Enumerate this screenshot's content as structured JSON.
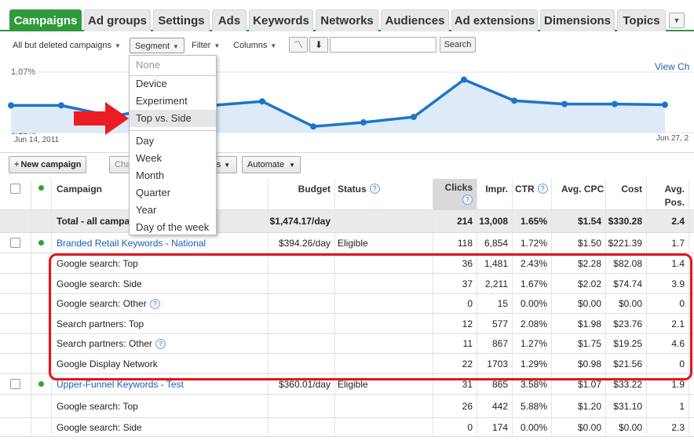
{
  "tabs": [
    "Campaigns",
    "Ad groups",
    "Settings",
    "Ads",
    "Keywords",
    "Networks",
    "Audiences",
    "Ad extensions",
    "Dimensions",
    "Topics"
  ],
  "toolbar": {
    "filter_view": "All but deleted campaigns",
    "segment": "Segment",
    "filter": "Filter",
    "columns": "Columns",
    "search_button": "Search",
    "search_value": ""
  },
  "chart": {
    "y_max_label": "1.07%",
    "y_min_label": "0.18%",
    "x_start": "Jun 14, 2011",
    "x_end": "Jun 27, 2",
    "link": "View Ch",
    "line_color": "#1b76c8",
    "fill_color": "#dcebf7",
    "y_range": [
      0.18,
      1.07
    ],
    "values": [
      0.58,
      0.58,
      0.42,
      0.55,
      0.58,
      0.64,
      0.27,
      0.33,
      0.41,
      0.96,
      0.65,
      0.6,
      0.6,
      0.59
    ]
  },
  "segment_menu": {
    "items": [
      "None",
      "Device",
      "Experiment",
      "Top vs. Side",
      "Day",
      "Week",
      "Month",
      "Quarter",
      "Year",
      "Day of the week"
    ],
    "selected": "Top vs. Side"
  },
  "toolbar2": {
    "new_campaign": "New campaign",
    "change_partial": "Cha",
    "alerts_partial": "rts",
    "automate": "Automate"
  },
  "table": {
    "headers": {
      "campaign": "Campaign",
      "budget": "Budget",
      "status": "Status",
      "clicks": "Clicks",
      "impr": "Impr.",
      "ctr": "CTR",
      "cpc": "Avg. CPC",
      "cost": "Cost",
      "pos1": "Avg.",
      "pos2": "Pos."
    },
    "total": {
      "label": "Total - all campa",
      "budget": "$1,474.17/day",
      "clicks": "214",
      "impr": "13,008",
      "ctr": "1.65%",
      "cpc": "$1.54",
      "cost": "$330.28",
      "pos": "2.4"
    },
    "rows": [
      {
        "type": "campaign",
        "name": "Branded Retail Keywords - National",
        "budget": "$394.26/day",
        "status": "Eligible",
        "clicks": "118",
        "impr": "6,854",
        "ctr": "1.72%",
        "cpc": "$1.50",
        "cost": "$221.39",
        "pos": "1.7"
      },
      {
        "type": "segment",
        "name": "Google search: Top",
        "help": false,
        "clicks": "36",
        "impr": "1,481",
        "ctr": "2.43%",
        "cpc": "$2.28",
        "cost": "$82.08",
        "pos": "1.4"
      },
      {
        "type": "segment",
        "name": "Google search: Side",
        "help": false,
        "clicks": "37",
        "impr": "2,211",
        "ctr": "1.67%",
        "cpc": "$2.02",
        "cost": "$74.74",
        "pos": "3.9"
      },
      {
        "type": "segment",
        "name": "Google search: Other",
        "help": true,
        "clicks": "0",
        "impr": "15",
        "ctr": "0.00%",
        "cpc": "$0.00",
        "cost": "$0.00",
        "pos": "0"
      },
      {
        "type": "segment",
        "name": "Search partners: Top",
        "help": false,
        "clicks": "12",
        "impr": "577",
        "ctr": "2.08%",
        "cpc": "$1.98",
        "cost": "$23.76",
        "pos": "2.1"
      },
      {
        "type": "segment",
        "name": "Search partners: Other",
        "help": true,
        "clicks": "11",
        "impr": "867",
        "ctr": "1.27%",
        "cpc": "$1.75",
        "cost": "$19.25",
        "pos": "4.6"
      },
      {
        "type": "segment",
        "name": "Google Display Network",
        "help": false,
        "clicks": "22",
        "impr": "1703",
        "ctr": "1.29%",
        "cpc": "$0.98",
        "cost": "$21.56",
        "pos": "0"
      },
      {
        "type": "campaign",
        "name": "Upper-Funnel Keywords - Test",
        "budget": "$360.01/day",
        "status": "Eligible",
        "clicks": "31",
        "impr": "865",
        "ctr": "3.58%",
        "cpc": "$1.07",
        "cost": "$33.22",
        "pos": "1.9"
      },
      {
        "type": "segment",
        "name": "Google search: Top",
        "help": false,
        "clicks": "26",
        "impr": "442",
        "ctr": "5.88%",
        "cpc": "$1.20",
        "cost": "$31.10",
        "pos": "1"
      },
      {
        "type": "segment",
        "name": "Google search: Side",
        "help": false,
        "clicks": "0",
        "impr": "174",
        "ctr": "0.00%",
        "cpc": "$0.00",
        "cost": "$0.00",
        "pos": "2.3"
      }
    ]
  }
}
